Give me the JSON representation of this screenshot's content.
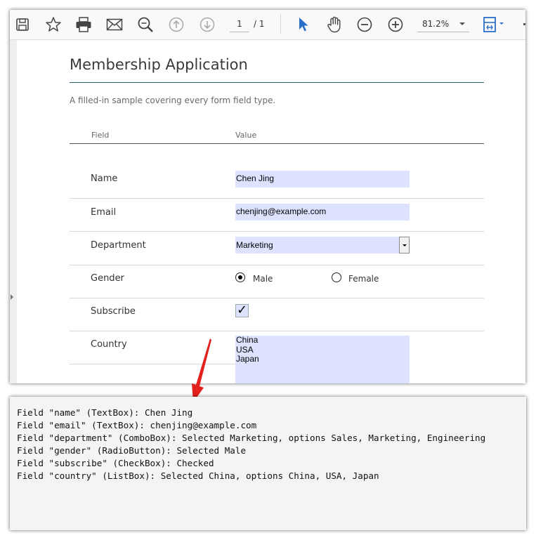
{
  "toolbar": {
    "page_current": "1",
    "page_total": "/ 1",
    "zoom": "81.2%",
    "icons": [
      "save-icon",
      "bookmark-star-icon",
      "print-icon",
      "email-icon",
      "search-zoom-icon",
      "page-up-icon",
      "page-down-icon",
      "select-cursor-icon",
      "hand-pan-icon",
      "zoom-out-icon",
      "zoom-in-icon",
      "fit-page-icon"
    ],
    "accent": "#2a6fc9"
  },
  "document": {
    "title": "Membership Application",
    "subtitle": "A filled-in sample covering every form field type.",
    "col_field": "Field",
    "col_value": "Value",
    "rows": {
      "name": {
        "label": "Name",
        "value": "Chen Jing"
      },
      "email": {
        "label": "Email",
        "value": "chenjing@example.com"
      },
      "department": {
        "label": "Department",
        "value": "Marketing"
      },
      "gender": {
        "label": "Gender",
        "option_male": "Male",
        "option_female": "Female",
        "selected": "Male"
      },
      "subscribe": {
        "label": "Subscribe",
        "checked": true
      },
      "country": {
        "label": "Country",
        "items": [
          "China",
          "USA",
          "Japan"
        ]
      }
    },
    "field_fill": "#dde3ff"
  },
  "console": {
    "lines": [
      "Field \"name\" (TextBox): Chen Jing",
      "Field \"email\" (TextBox): chenjing@example.com",
      "Field \"department\" (ComboBox): Selected Marketing, options Sales, Marketing, Engineering",
      "Field \"gender\" (RadioButton): Selected Male",
      "Field \"subscribe\" (CheckBox): Checked",
      "Field \"country\" (ListBox): Selected China, options China, USA, Japan"
    ]
  },
  "arrow_color": "#e3201b"
}
